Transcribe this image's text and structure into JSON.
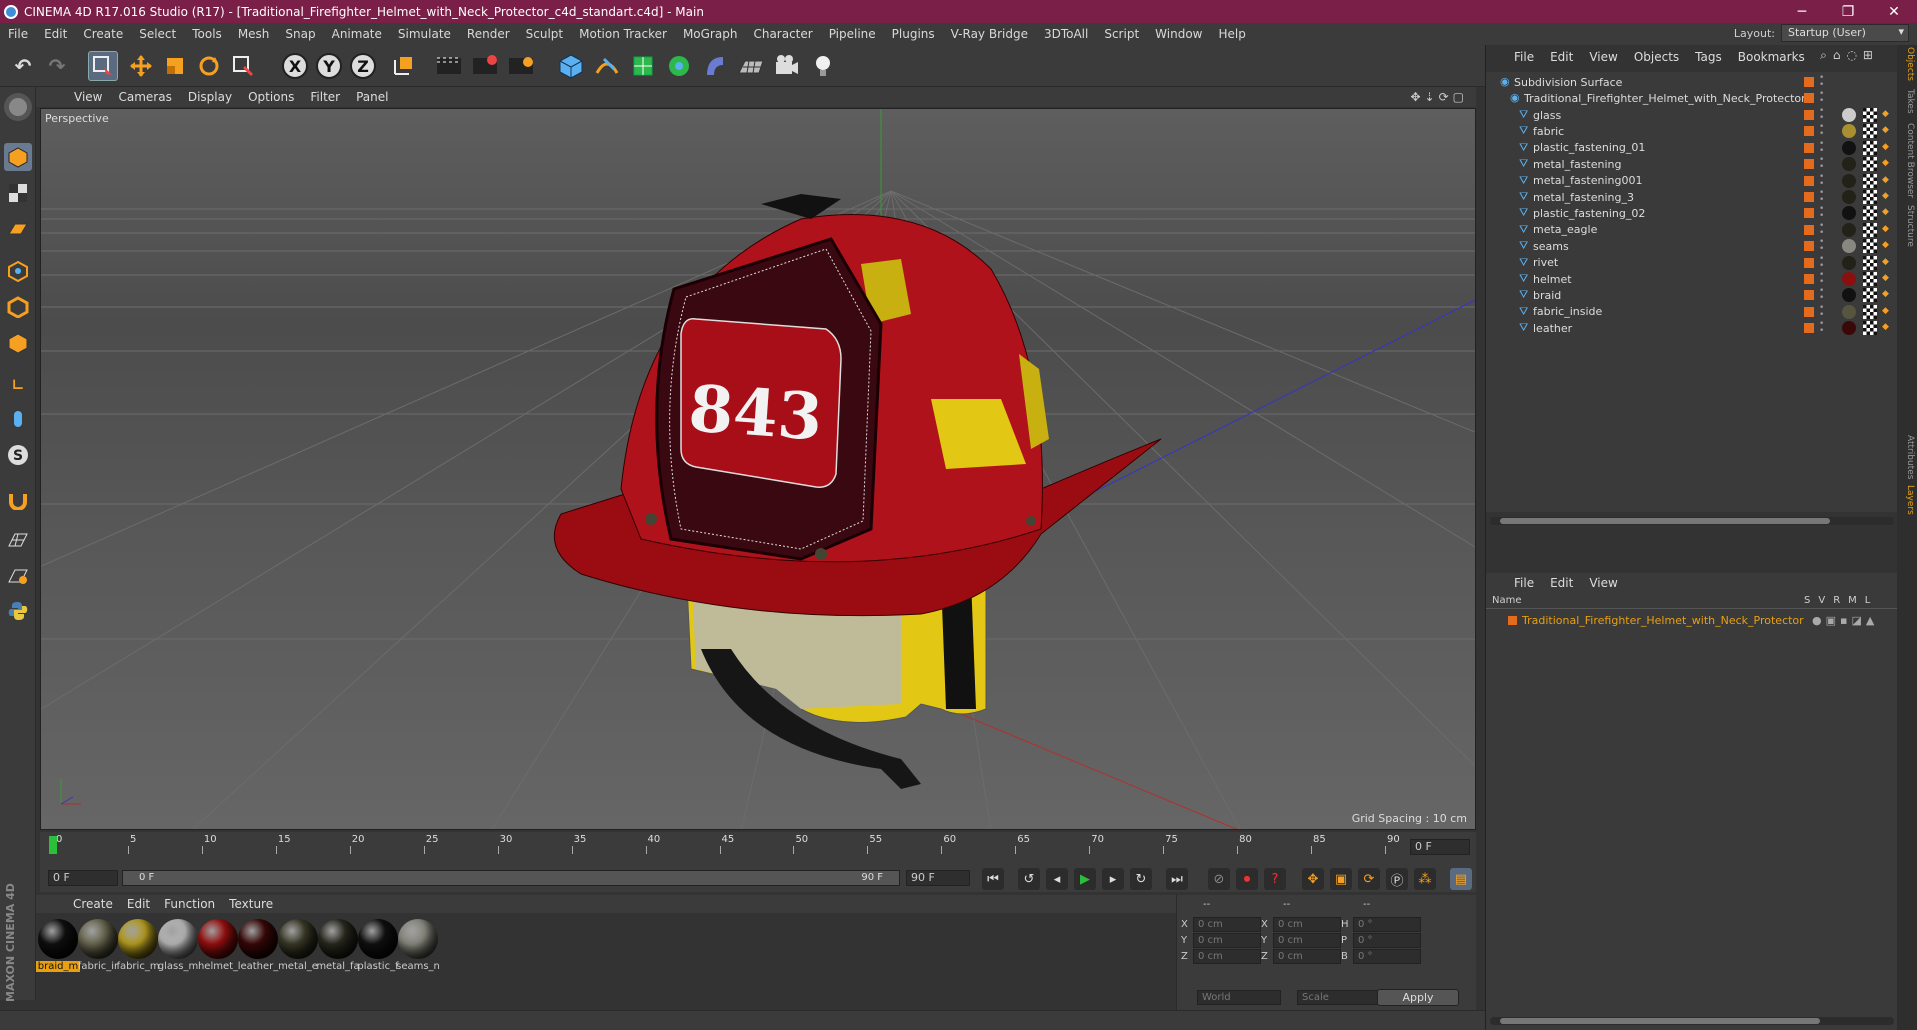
{
  "window": {
    "title": "CINEMA 4D R17.016 Studio (R17) - [Traditional_Firefighter_Helmet_with_Neck_Protector_c4d_standart.c4d] - Main"
  },
  "menubar": {
    "items": [
      "File",
      "Edit",
      "Create",
      "Select",
      "Tools",
      "Mesh",
      "Snap",
      "Animate",
      "Simulate",
      "Render",
      "Sculpt",
      "Motion Tracker",
      "MoGraph",
      "Character",
      "Pipeline",
      "Plugins",
      "V-Ray Bridge",
      "3DToAll",
      "Script",
      "Window",
      "Help"
    ],
    "layout_label": "Layout:",
    "layout_value": "Startup (User)"
  },
  "viewport": {
    "menu": [
      "View",
      "Cameras",
      "Display",
      "Options",
      "Filter",
      "Panel"
    ],
    "label": "Perspective",
    "grid_spacing": "Grid Spacing : 10 cm",
    "helmet_number": "843"
  },
  "timeline": {
    "ticks": [
      "0",
      "5",
      "10",
      "15",
      "20",
      "25",
      "30",
      "35",
      "40",
      "45",
      "50",
      "55",
      "60",
      "65",
      "70",
      "75",
      "80",
      "85",
      "90"
    ],
    "end_field": "0 F",
    "current_frame": "0 F",
    "range_start": "0 F",
    "range_end": "90 F",
    "max_frame": "90 F"
  },
  "materials": {
    "menu": [
      "Create",
      "Edit",
      "Function",
      "Texture"
    ],
    "items": [
      {
        "label": "braid_m",
        "color": "#101010"
      },
      {
        "label": "fabric_ir",
        "color": "#6b6850"
      },
      {
        "label": "fabric_m",
        "color": "#b8a020"
      },
      {
        "label": "glass_m",
        "color": "#bbbbbb"
      },
      {
        "label": "helmet_",
        "color": "#9a1010"
      },
      {
        "label": "leather_",
        "color": "#3a0808"
      },
      {
        "label": "metal_e",
        "color": "#3a3a28"
      },
      {
        "label": "metal_fa",
        "color": "#2a2a20"
      },
      {
        "label": "plastic_f",
        "color": "#111111"
      },
      {
        "label": "seams_n",
        "color": "#8a8a80"
      }
    ],
    "maxon_text": "MAXON CINEMA 4D"
  },
  "coords": {
    "header1": "--",
    "header2": "--",
    "header3": "--",
    "rows": [
      {
        "axis": "X",
        "val": "0 cm",
        "axis2": "X",
        "val2": "0 cm",
        "axis3": "H",
        "val3": "0 °"
      },
      {
        "axis": "Y",
        "val": "0 cm",
        "axis2": "Y",
        "val2": "0 cm",
        "axis3": "P",
        "val3": "0 °"
      },
      {
        "axis": "Z",
        "val": "0 cm",
        "axis2": "Z",
        "val2": "0 cm",
        "axis3": "B",
        "val3": "0 °"
      }
    ],
    "world": "World",
    "scale": "Scale",
    "apply": "Apply"
  },
  "object_manager": {
    "menu": [
      "File",
      "Edit",
      "View",
      "Objects",
      "Tags",
      "Bookmarks"
    ],
    "root": "Subdivision Surface",
    "parent": "Traditional_Firefighter_Helmet_with_Neck_Protector",
    "children": [
      {
        "name": "glass",
        "mat": "#cccccc"
      },
      {
        "name": "fabric",
        "mat": "#a89030"
      },
      {
        "name": "plastic_fastening_01",
        "mat": "#111111"
      },
      {
        "name": "metal_fastening",
        "mat": "#222218"
      },
      {
        "name": "metal_fastening001",
        "mat": "#222218"
      },
      {
        "name": "metal_fastening_3",
        "mat": "#222218"
      },
      {
        "name": "plastic_fastening_02",
        "mat": "#111111"
      },
      {
        "name": "meta_eagle",
        "mat": "#222218"
      },
      {
        "name": "seams",
        "mat": "#888880"
      },
      {
        "name": "rivet",
        "mat": "#222218"
      },
      {
        "name": "helmet",
        "mat": "#8a1010"
      },
      {
        "name": "braid",
        "mat": "#111111"
      },
      {
        "name": "fabric_inside",
        "mat": "#555540"
      },
      {
        "name": "leather",
        "mat": "#3a0808"
      }
    ]
  },
  "layer_manager": {
    "menu": [
      "File",
      "Edit",
      "View"
    ],
    "col_name": "Name",
    "col_flags": [
      "S",
      "V",
      "R",
      "M",
      "L"
    ],
    "item": "Traditional_Firefighter_Helmet_with_Neck_Protector"
  },
  "side_tabs": [
    "Objects",
    "Takes",
    "Content Browser",
    "Structure",
    "Attributes",
    "Layers"
  ]
}
